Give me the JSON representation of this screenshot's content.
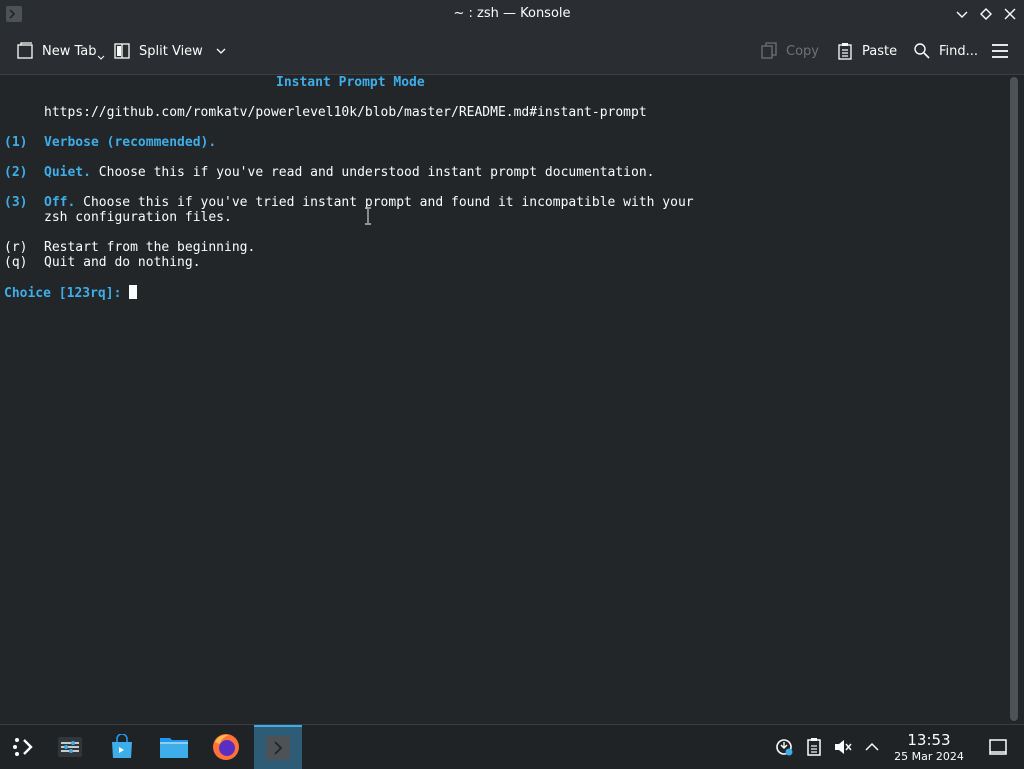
{
  "window": {
    "title": "~ : zsh — Konsole"
  },
  "toolbar": {
    "new_tab_label": "New Tab",
    "split_view_label": "Split View",
    "copy_label": "Copy",
    "paste_label": "Paste",
    "find_label": "Find..."
  },
  "terminal": {
    "heading": "Instant Prompt Mode",
    "url": "https://github.com/romkatv/powerlevel10k/blob/master/README.md#instant-prompt",
    "option1_key": "(1)",
    "option1_name": "Verbose (recommended).",
    "option2_key": "(2)",
    "option2_name": "Quiet.",
    "option2_desc": " Choose this if you've read and understood instant prompt documentation.",
    "option3_key": "(3)",
    "option3_name": "Off.",
    "option3_desc": " Choose this if you've tried instant prompt and found it incompatible with your",
    "option3_desc2": "zsh configuration files.",
    "restart_key": "(r)",
    "restart_text": "Restart from the beginning.",
    "quit_key": "(q)",
    "quit_text": "Quit and do nothing.",
    "prompt": "Choice [123rq]: "
  },
  "taskbar": {
    "items": [
      "application-launcher-icon",
      "system-settings-icon",
      "discover-store-icon",
      "dolphin-files-icon",
      "firefox-icon",
      "konsole-icon"
    ],
    "tray": [
      "network-update-icon",
      "clipboard-icon",
      "volume-muted-icon",
      "tray-expand-icon"
    ],
    "time": "13:53",
    "date": "25 Mar 2024"
  },
  "colors": {
    "accent": "#3daee9",
    "background": "#232629",
    "text": "#fcfcfc"
  }
}
